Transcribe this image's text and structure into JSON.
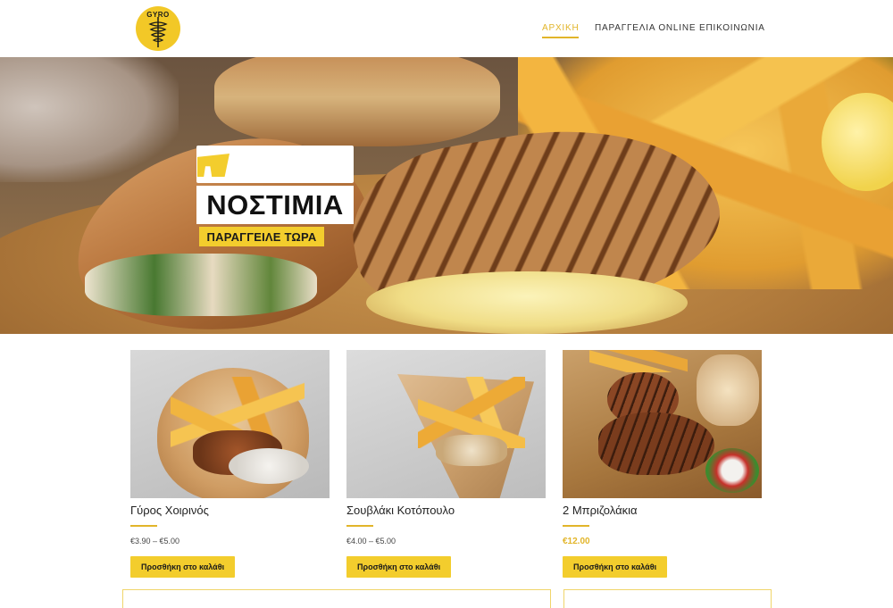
{
  "header": {
    "logo_text": "GYRO",
    "nav": [
      {
        "label": "ΑΡΧΙΚΗ",
        "active": true
      },
      {
        "label": "ΠΑΡΑΓΓΕΛΙΑ ONLINE",
        "active": false
      },
      {
        "label": "ΕΠΙΚΟΙΝΩΝΙΑ",
        "active": false
      }
    ]
  },
  "hero": {
    "title": "ΝΟΣΤΙΜΙΑ",
    "cta_label": "ΠΑΡΑΓΓΕΙΛΕ ΤΩΡΑ"
  },
  "products": [
    {
      "name": "Γύρος Χοιρινός",
      "price": "€3.90 – €5.00",
      "button": "Προσθήκη στο καλάθι"
    },
    {
      "name": "Σουβλάκι Κοτόπουλο",
      "price": "€4.00 – €5.00",
      "button": "Προσθήκη στο καλάθι"
    },
    {
      "name": "2 Μπριζολάκια",
      "price": "€12.00",
      "button": "Προσθήκη στο καλάθι"
    }
  ],
  "colors": {
    "accent": "#e2b52a",
    "button": "#f3cd2d",
    "text": "#222222"
  }
}
